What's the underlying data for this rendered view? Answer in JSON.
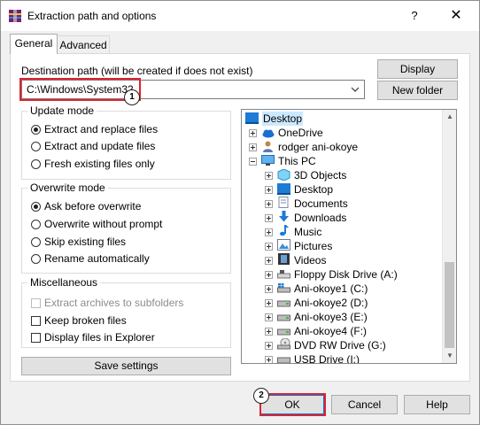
{
  "window": {
    "title": "Extraction path and options",
    "help_glyph": "?",
    "close_glyph": "✕"
  },
  "tabs": [
    {
      "label": "General",
      "active": true
    },
    {
      "label": "Advanced",
      "active": false
    }
  ],
  "destination": {
    "label": "Destination path (will be created if does not exist)",
    "value": "C:\\Windows\\System32"
  },
  "buttons": {
    "display": "Display",
    "new_folder": "New folder",
    "save_settings": "Save settings",
    "ok": "OK",
    "cancel": "Cancel",
    "help": "Help"
  },
  "update_mode": {
    "title": "Update mode",
    "options": [
      {
        "label": "Extract and replace files",
        "selected": true
      },
      {
        "label": "Extract and update files",
        "selected": false
      },
      {
        "label": "Fresh existing files only",
        "selected": false
      }
    ]
  },
  "overwrite_mode": {
    "title": "Overwrite mode",
    "options": [
      {
        "label": "Ask before overwrite",
        "selected": true
      },
      {
        "label": "Overwrite without prompt",
        "selected": false
      },
      {
        "label": "Skip existing files",
        "selected": false
      },
      {
        "label": "Rename automatically",
        "selected": false
      }
    ]
  },
  "misc": {
    "title": "Miscellaneous",
    "options": [
      {
        "label": "Extract archives to subfolders",
        "checked": false,
        "disabled": true
      },
      {
        "label": "Keep broken files",
        "checked": false,
        "disabled": false
      },
      {
        "label": "Display files in Explorer",
        "checked": false,
        "disabled": false
      }
    ]
  },
  "tree": {
    "items": [
      {
        "label": "Desktop",
        "icon": "desktop-blue-icon"
      },
      {
        "label": "OneDrive",
        "icon": "cloud-icon"
      },
      {
        "label": "rodger ani-okoye",
        "icon": "user-icon"
      },
      {
        "label": "This PC",
        "icon": "monitor-icon"
      },
      {
        "label": "3D Objects",
        "icon": "cube-icon"
      },
      {
        "label": "Desktop",
        "icon": "desktop-folder-icon"
      },
      {
        "label": "Documents",
        "icon": "document-icon"
      },
      {
        "label": "Downloads",
        "icon": "download-arrow-icon"
      },
      {
        "label": "Music",
        "icon": "music-note-icon"
      },
      {
        "label": "Pictures",
        "icon": "picture-icon"
      },
      {
        "label": "Videos",
        "icon": "film-icon"
      },
      {
        "label": "Floppy Disk Drive (A:)",
        "icon": "floppy-drive-icon"
      },
      {
        "label": "Ani-okoye1 (C:)",
        "icon": "windows-drive-icon"
      },
      {
        "label": "Ani-okoye2 (D:)",
        "icon": "hard-drive-icon"
      },
      {
        "label": "Ani-okoye3 (E:)",
        "icon": "hard-drive-icon"
      },
      {
        "label": "Ani-okoye4 (F:)",
        "icon": "hard-drive-icon"
      },
      {
        "label": "DVD RW Drive (G:)",
        "icon": "dvd-icon"
      },
      {
        "label": "USB Drive (I:)",
        "icon": "usb-drive-icon"
      }
    ]
  },
  "annotations": {
    "badge1": "1",
    "badge2": "2",
    "highlight_color": "#e3202e"
  }
}
